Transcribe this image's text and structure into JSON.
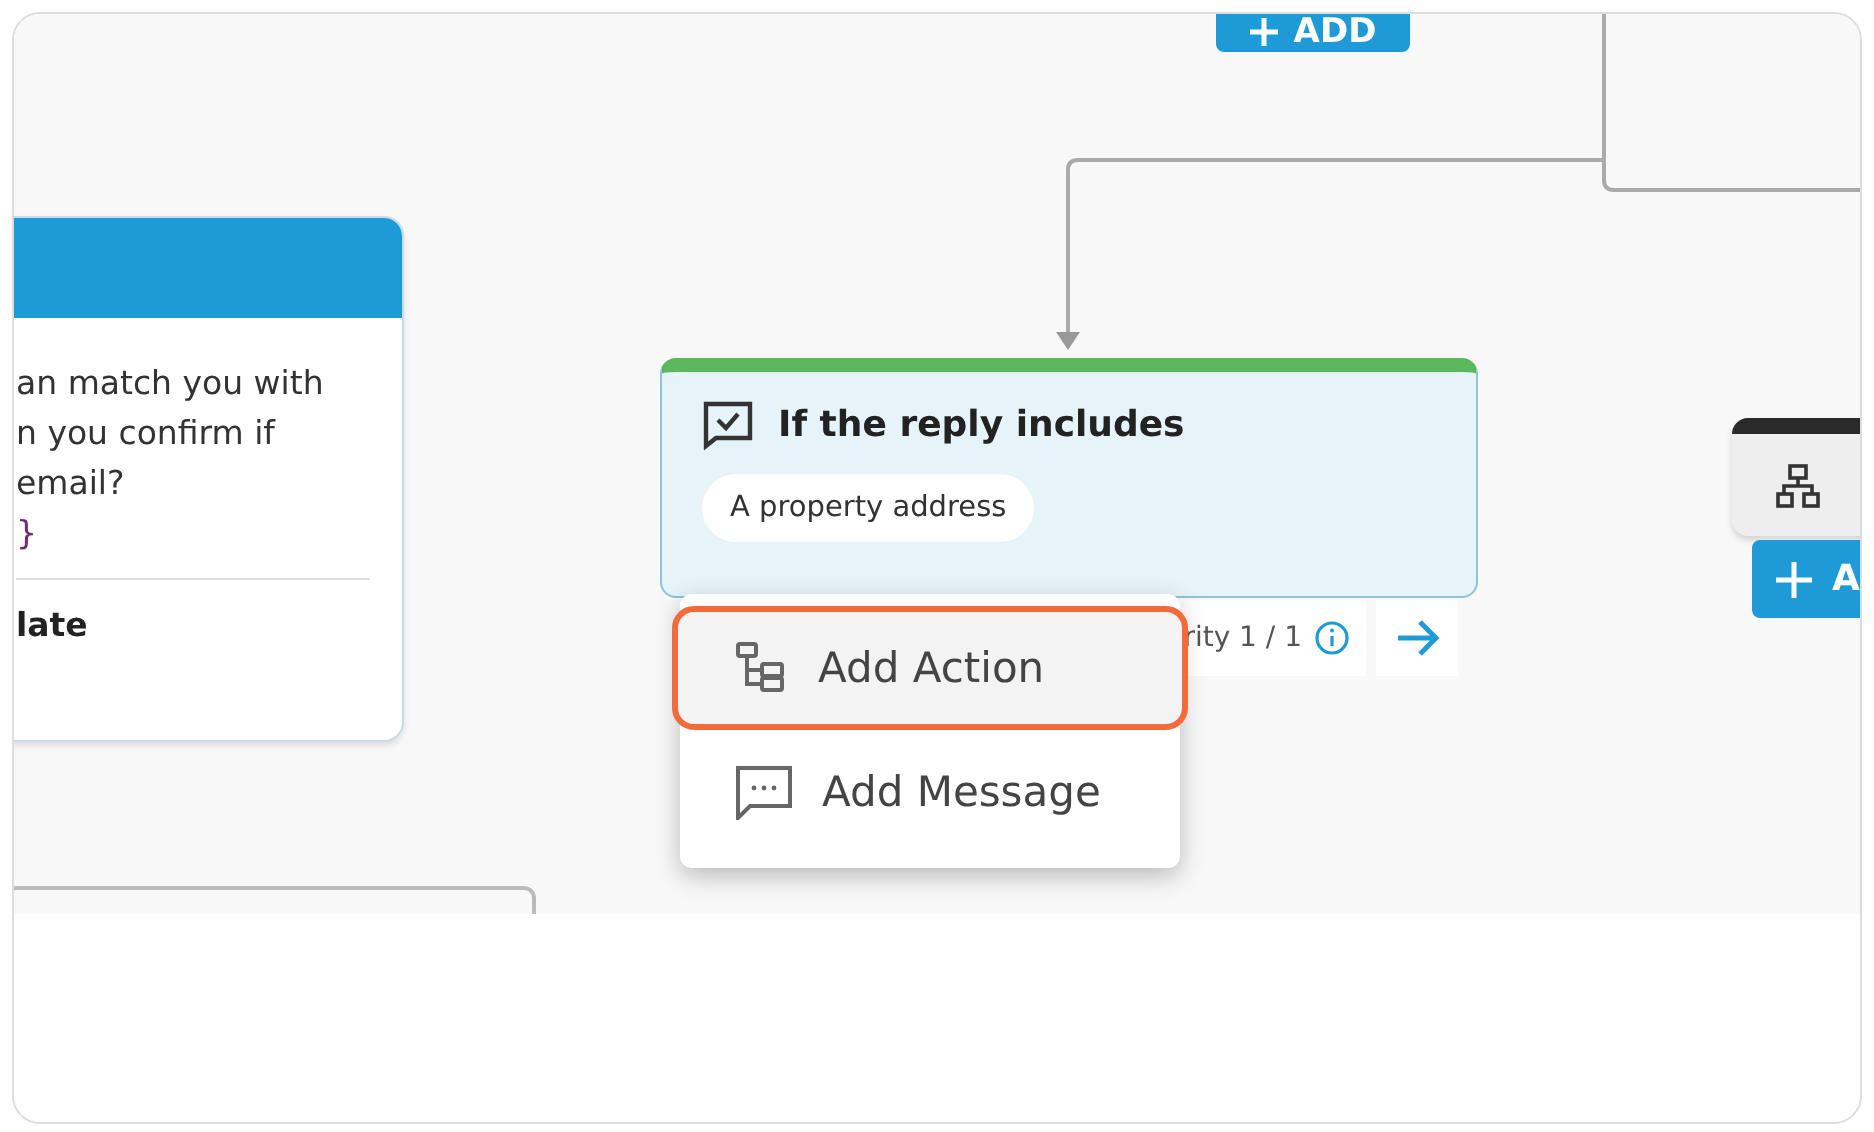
{
  "top_button": {
    "label": "ADD"
  },
  "message_card": {
    "lines": [
      {
        "kind": "text",
        "text": "an match you with"
      },
      {
        "kind": "text",
        "text": "n you confirm if"
      },
      {
        "kind": "text",
        "text": "email?"
      },
      {
        "kind": "variable",
        "text": "}"
      }
    ],
    "footer": "late"
  },
  "condition_card": {
    "title": "If the reply includes",
    "chips": [
      "A property address"
    ],
    "priority": "rity 1 / 1"
  },
  "context_menu": {
    "items": [
      {
        "kind": "action",
        "label": "Add Action",
        "selected": true
      },
      {
        "kind": "message",
        "label": "Add Message",
        "selected": false
      }
    ]
  },
  "action_node": {
    "button": "A"
  }
}
